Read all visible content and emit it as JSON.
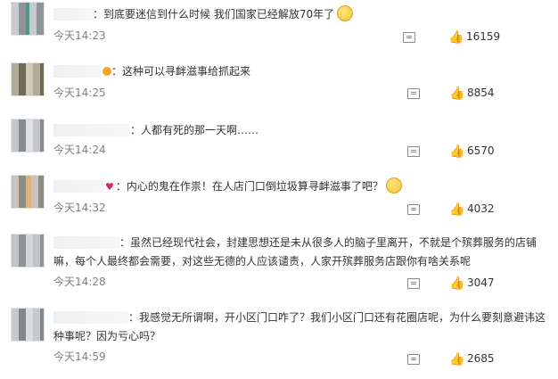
{
  "comments": [
    {
      "username": "████",
      "separator": "：",
      "text": "到底要迷信到什么时候 我们国家已经解放70年了",
      "emoji": "smile",
      "timestamp": "今天14:23",
      "likes": "16159"
    },
    {
      "username": "████",
      "separator": "：",
      "text": "这种可以寻衅滋事给抓起来",
      "timestamp": "今天14:25",
      "likes": "8854"
    },
    {
      "username": "████",
      "separator": "：",
      "text": "人都有死的那一天啊……",
      "timestamp": "今天14:24",
      "likes": "6570"
    },
    {
      "username": "████",
      "separator": "：",
      "text": "内心的鬼在作祟！在人店门口倒垃圾算寻衅滋事了吧？",
      "emoji": "thinking",
      "timestamp": "今天14:32",
      "likes": "4032"
    },
    {
      "username": "████",
      "separator": "：",
      "text_line1": "虽然已经现代社会，封建思想还是未从很多人的脑子里离开，不就是个殡葬服务的店铺",
      "text_line2": "嘛，每个人最终都会需要，对这些无德的人应该谴责，人家开殡葬服务店跟你有啥关系呢",
      "timestamp": "今天14:28",
      "likes": "3047"
    },
    {
      "username": "████",
      "separator": "：",
      "text_line1": "我感觉无所谓啊，开小区门口咋了？我们小区门口还有花圈店呢，为什么要刻意避讳这",
      "text_line2": "种事呢？因为亏心吗？",
      "timestamp": "今天14:59",
      "likes": "2685"
    }
  ],
  "icons": {
    "reply": "comment-icon",
    "like": "thumbs-up-icon"
  },
  "colors": {
    "text": "#333333",
    "timestamp": "#808080",
    "icon": "#8a8a8a"
  }
}
